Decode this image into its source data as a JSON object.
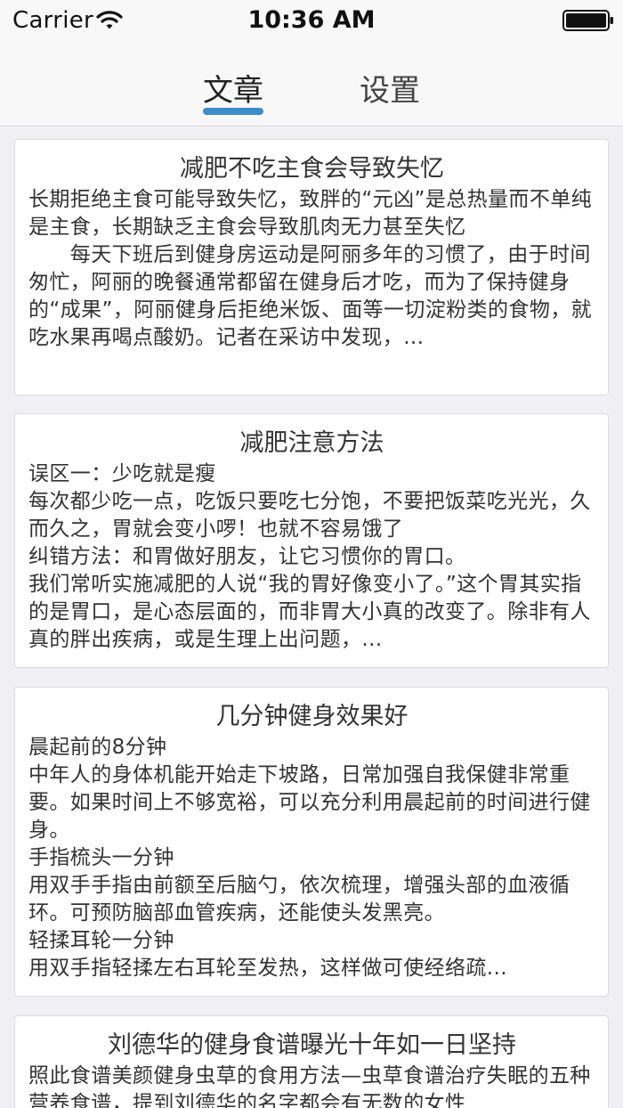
{
  "status_bar": {
    "carrier": "Carrier",
    "time": "10:36 AM"
  },
  "tabs": [
    {
      "label": "文章",
      "active": true
    },
    {
      "label": "设置",
      "active": false
    }
  ],
  "colors": {
    "accent": "#3d8dc9",
    "background": "#efeff4",
    "card": "#ffffff"
  },
  "articles": [
    {
      "title": "减肥不吃主食会导致失忆",
      "body": "长期拒绝主食可能导致失忆，致胖的“元凶”是总热量而不单纯是主食，长期缺乏主食会导致肌肉无力甚至失忆\n　　每天下班后到健身房运动是阿丽多年的习惯了，由于时间匆忙，阿丽的晚餐通常都留在健身后才吃，而为了保持健身的“成果”，阿丽健身后拒绝米饭、面等一切淀粉类的食物，就吃水果再喝点酸奶。记者在采访中发现，..."
    },
    {
      "title": "减肥注意方法",
      "body": "误区一：少吃就是瘦\n每次都少吃一点，吃饭只要吃七分饱，不要把饭菜吃光光，久而久之，胃就会变小啰！也就不容易饿了\n纠错方法：和胃做好朋友，让它习惯你的胃口。\n我们常听实施减肥的人说“我的胃好像变小了。”这个胃其实指的是胃口，是心态层面的，而非胃大小真的改变了。除非有人真的胖出疾病，或是生理上出问题，..."
    },
    {
      "title": "几分钟健身效果好",
      "body": "晨起前的8分钟\n中年人的身体机能开始走下坡路，日常加强自我保健非常重要。如果时间上不够宽裕，可以充分利用晨起前的时间进行健身。\n手指梳头一分钟\n用双手手指由前额至后脑勺，依次梳理，增强头部的血液循环。可预防脑部血管疾病，还能使头发黑亮。\n轻揉耳轮一分钟\n用双手指轻揉左右耳轮至发热，这样做可使经络疏..."
    },
    {
      "title": "刘德华的健身食谱曝光十年如一日坚持",
      "body": "照此食谱美颜健身虫草的食用方法—虫草食谱治疗失眠的五种营养食谱，提到刘德华的名字都会有无数的女性"
    }
  ]
}
